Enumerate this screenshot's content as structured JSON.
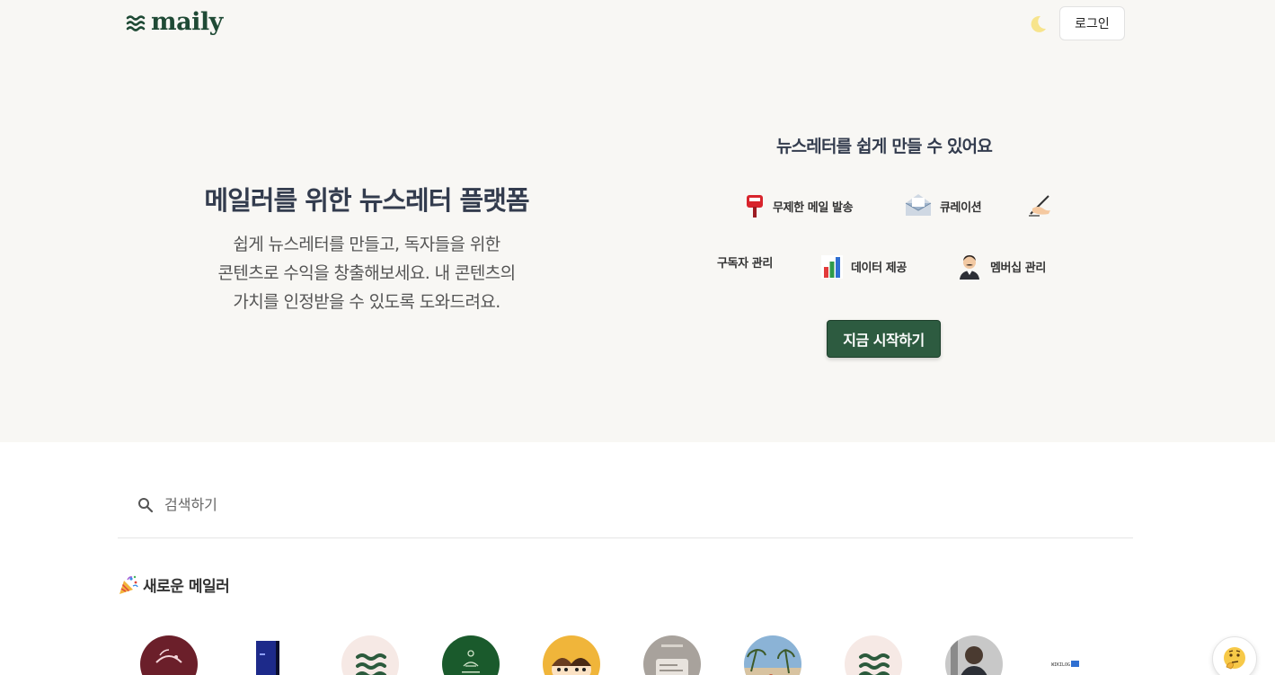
{
  "header": {
    "logo_text": "maily",
    "login_label": "로그인",
    "theme_toggle_icon": "moon-icon"
  },
  "hero": {
    "title": "메일러를 위한 뉴스레터 플랫폼",
    "subtitle_lines": [
      "쉽게 뉴스레터를 만들고, 독자들을 위한",
      "콘텐츠로 수익을 창출해보세요. 내 콘텐츠의",
      "가치를 인정받을 수 있도록 도와드려요."
    ]
  },
  "features": {
    "title": "뉴스레터를 쉽게 만들 수 있어요",
    "items": [
      {
        "label": "무제한 메일 발송",
        "icon": "mailbox-icon"
      },
      {
        "label": "큐레이션",
        "icon": "envelope-icon"
      },
      {
        "label": "",
        "icon": "writing-hand-icon"
      },
      {
        "label": "구독자 관리",
        "icon": ""
      },
      {
        "label": "데이터 제공",
        "icon": "bar-chart-icon"
      },
      {
        "label": "멤버십 관리",
        "icon": "man-in-suit-icon"
      }
    ],
    "cta_label": "지금 시작하기"
  },
  "search": {
    "placeholder": "검색하기",
    "value": ""
  },
  "new_mailers": {
    "title": "새로운 메일러",
    "title_icon": "party-popper-icon",
    "avatars": [
      {
        "name": "avatar-maroon",
        "color": "#6b1f2a"
      },
      {
        "name": "avatar-blue-book",
        "color": "#1d2a8a"
      },
      {
        "name": "avatar-maily-default",
        "color": "#f3e6e2"
      },
      {
        "name": "avatar-green-yoga",
        "color": "#1d5a2e"
      },
      {
        "name": "avatar-cartoon-couple",
        "color": "#f0b53a"
      },
      {
        "name": "avatar-blurred-doc",
        "color": "#a8a29c"
      },
      {
        "name": "avatar-beach",
        "color": "#7aa4c8"
      },
      {
        "name": "avatar-maily-default-2",
        "color": "#f3e6e2"
      },
      {
        "name": "avatar-person-photo",
        "color": "#3a3d44"
      },
      {
        "name": "avatar-wikilog",
        "color": "#ffffff"
      }
    ]
  },
  "help": {
    "icon": "thinking-face-icon"
  }
}
